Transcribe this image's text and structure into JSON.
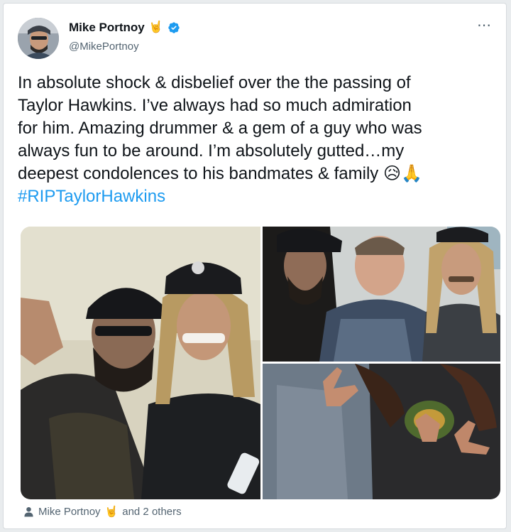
{
  "author": {
    "display_name": "Mike Portnoy",
    "name_emoji": "🤘",
    "handle": "@MikePortnoy",
    "verified": true,
    "avatar_icon": "profile-avatar"
  },
  "more_icon": "⋯",
  "tweet": {
    "lines": [
      "In absolute shock & disbelief over the the passing of",
      "Taylor Hawkins. I’ve always had so much admiration",
      "for him. Amazing drummer & a gem of a guy who was",
      "always fun to be around. I’m absolutely gutted…my",
      "deepest condolences to his bandmates & family"
    ],
    "emojis": "😥🙏",
    "hashtag": "#RIPTaylorHawkins"
  },
  "media": {
    "photos": [
      {
        "icon": "photo-two-men-in-caps"
      },
      {
        "icon": "photo-three-men-group"
      },
      {
        "icon": "photo-rock-horns-hands"
      }
    ]
  },
  "tags": {
    "icon": "person-icon",
    "name": "Mike Portnoy",
    "emoji": "🤘",
    "others": "and 2 others"
  },
  "colors": {
    "link": "#1d9bf0",
    "verified": "#1d9bf0",
    "text": "#0f1419",
    "secondary": "#536471"
  }
}
